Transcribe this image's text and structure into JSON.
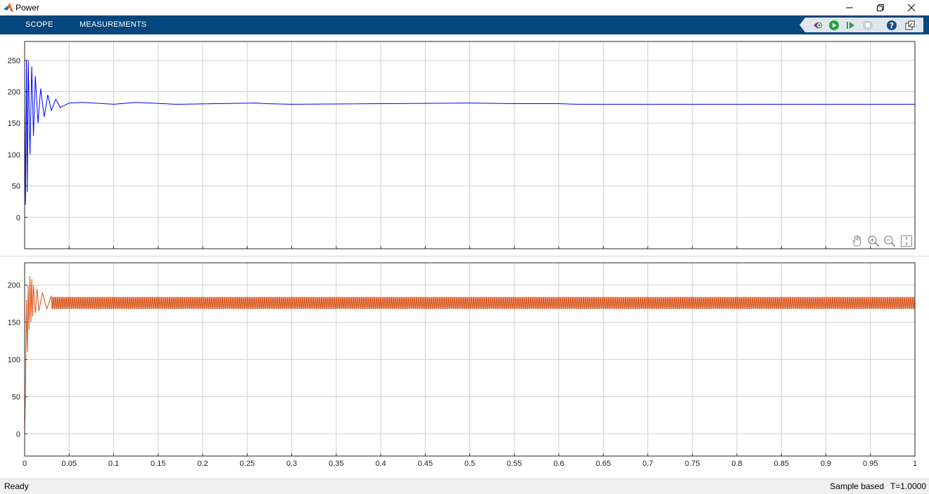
{
  "window": {
    "title": "Power"
  },
  "ribbon": {
    "tabs": [
      {
        "label": "SCOPE"
      },
      {
        "label": "MEASUREMENTS"
      }
    ]
  },
  "toolbar": {
    "icons": [
      "signal-selector-icon",
      "run-icon",
      "step-forward-icon",
      "stop-icon",
      "help-icon",
      "undock-icon"
    ]
  },
  "axes_toolbar": {
    "icons": [
      "pan-icon",
      "zoom-in-icon",
      "zoom-out-icon",
      "fit-axes-icon"
    ]
  },
  "colors": {
    "ribbon": "#04467d",
    "series1": "#0000ff",
    "series2": "#d95319",
    "grid": "#d0d0d0"
  },
  "chart_data": [
    {
      "type": "line",
      "xlim": [
        0,
        1
      ],
      "ylim": [
        -50,
        280
      ],
      "xticks": [
        0,
        0.05,
        0.1,
        0.15,
        0.2,
        0.25,
        0.3,
        0.35,
        0.4,
        0.45,
        0.5,
        0.55,
        0.6,
        0.65,
        0.7,
        0.75,
        0.8,
        0.85,
        0.9,
        0.95,
        1
      ],
      "xtick_labels_shown": false,
      "yticks": [
        0,
        50,
        100,
        150,
        200,
        250
      ],
      "grid": true,
      "series": [
        {
          "color": "#0000ff",
          "steady_value": 180,
          "x": [
            0,
            0.001,
            0.002,
            0.003,
            0.004,
            0.006,
            0.008,
            0.01,
            0.012,
            0.015,
            0.018,
            0.022,
            0.026,
            0.03,
            0.035,
            0.04,
            0.05,
            0.065,
            0.1,
            0.125,
            0.14,
            0.17,
            0.26,
            0.27,
            0.3,
            0.5,
            0.55,
            0.6,
            0.62,
            1.0
          ],
          "y": [
            180,
            20,
            250,
            40,
            250,
            100,
            240,
            130,
            225,
            150,
            205,
            160,
            195,
            170,
            188,
            175,
            182,
            183,
            180,
            183,
            182,
            180,
            182,
            181,
            180,
            182,
            181,
            181,
            180,
            180
          ]
        }
      ]
    },
    {
      "type": "line",
      "xlim": [
        0,
        1
      ],
      "ylim": [
        -30,
        230
      ],
      "xticks": [
        0,
        0.05,
        0.1,
        0.15,
        0.2,
        0.25,
        0.3,
        0.35,
        0.4,
        0.45,
        0.5,
        0.55,
        0.6,
        0.65,
        0.7,
        0.75,
        0.8,
        0.85,
        0.9,
        0.95,
        1
      ],
      "xtick_labels": [
        "0",
        "0.05",
        "0.1",
        "0.15",
        "0.2",
        "0.25",
        "0.3",
        "0.35",
        "0.4",
        "0.45",
        "0.5",
        "0.55",
        "0.6",
        "0.65",
        "0.7",
        "0.75",
        "0.8",
        "0.85",
        "0.9",
        "0.95",
        "1"
      ],
      "yticks": [
        0,
        50,
        100,
        150,
        200
      ],
      "grid": true,
      "series": [
        {
          "color": "#d95319",
          "band_min": 168,
          "band_max": 184,
          "x": [
            0,
            0.001,
            0.002,
            0.003,
            0.004,
            0.005,
            0.006,
            0.007,
            0.008,
            0.009,
            0.01,
            0.012,
            0.014,
            0.016,
            0.02,
            0.025,
            0.03
          ],
          "y": [
            0,
            60,
            180,
            110,
            200,
            140,
            212,
            150,
            208,
            158,
            200,
            162,
            195,
            165,
            190,
            168,
            186
          ]
        }
      ]
    }
  ],
  "status": {
    "left": "Ready",
    "mode": "Sample based",
    "time": "T=1.0000"
  }
}
